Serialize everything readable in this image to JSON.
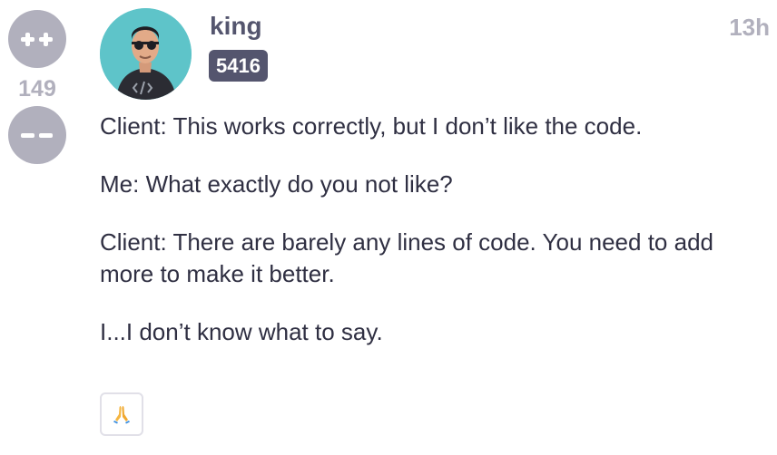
{
  "post": {
    "score": "149",
    "author": {
      "username": "king",
      "score_badge": "5416"
    },
    "time_ago": "13h",
    "paragraphs": [
      "Client: This works correctly, but I don’t like the code.",
      "Me: What exactly do you not like?",
      "Client: There are barely any lines of code. You need to add more to make it better.",
      "I...I don’t know what to say."
    ],
    "reaction": {
      "icon": "praying-hands-icon"
    }
  },
  "colors": {
    "vote_gray": "#b1b0bd",
    "name_slate": "#54556e",
    "avatar_bg": "#5ec4c9",
    "text": "#2f2f42"
  }
}
